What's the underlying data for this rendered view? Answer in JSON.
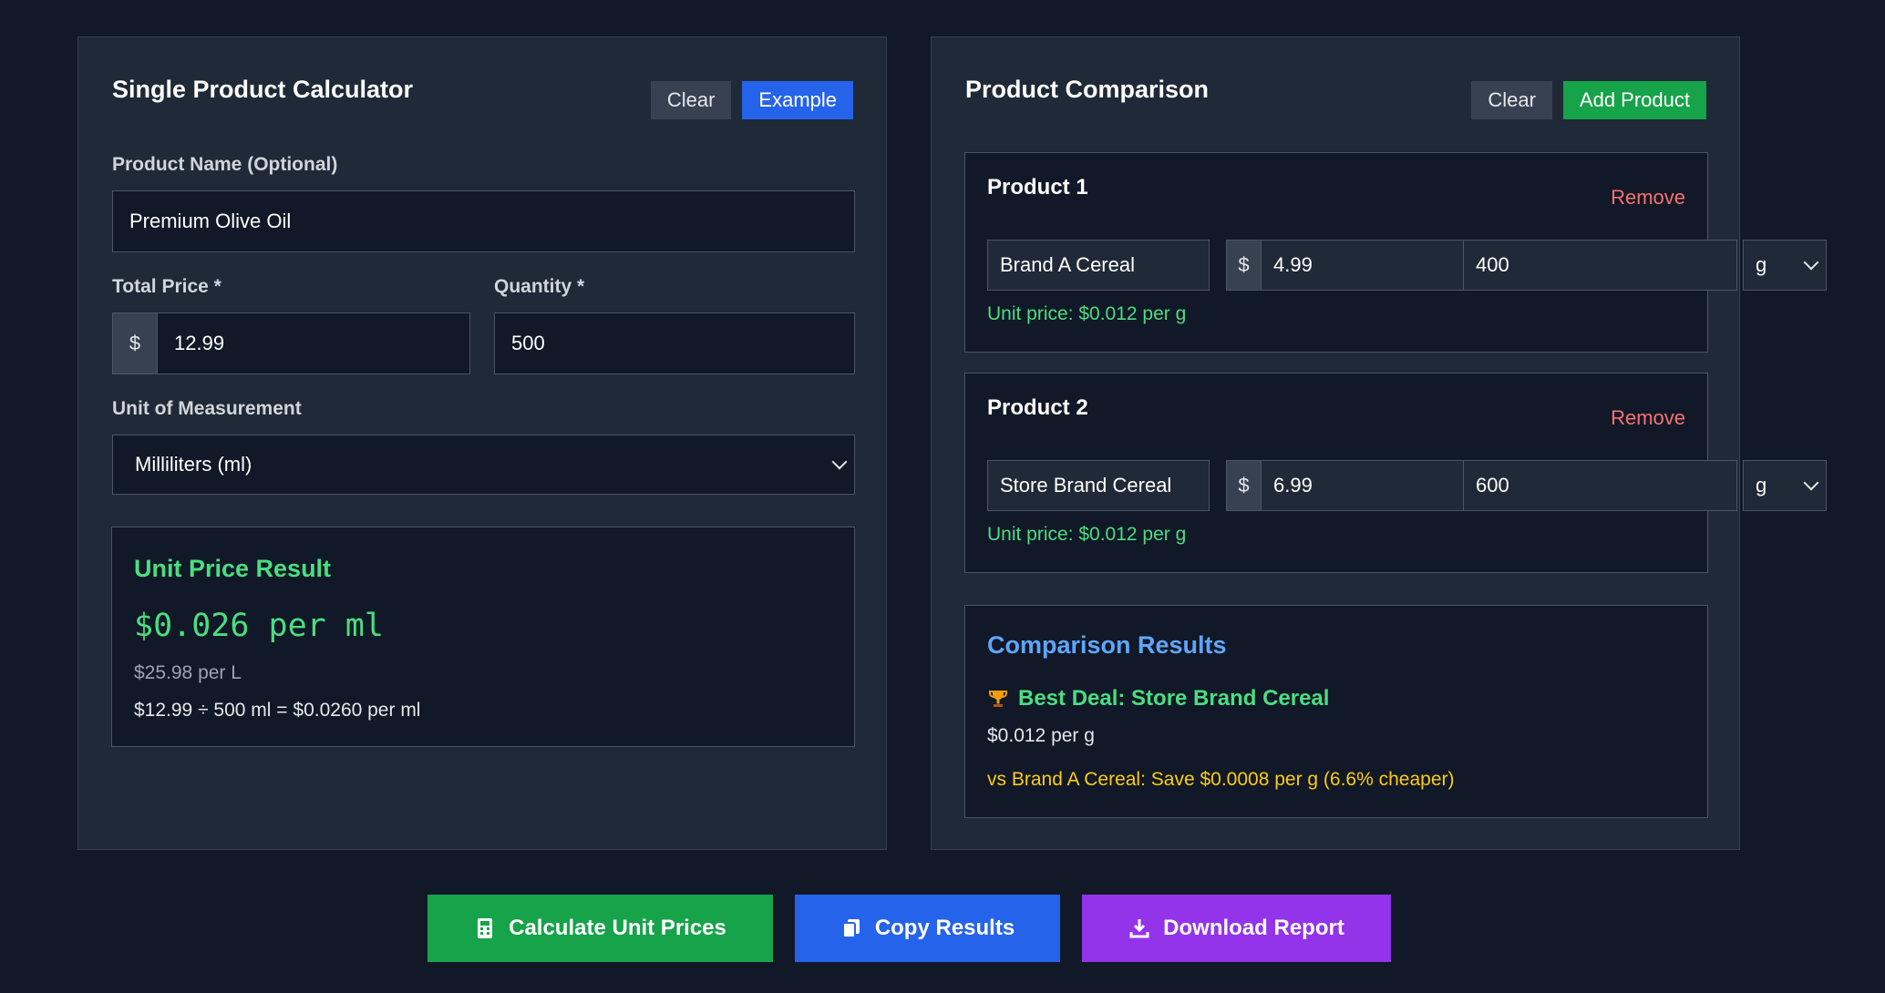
{
  "single": {
    "title": "Single Product Calculator",
    "clear_label": "Clear",
    "example_label": "Example",
    "product_name_label": "Product Name (Optional)",
    "product_name_value": "Premium Olive Oil",
    "total_price_label": "Total Price *",
    "currency_symbol": "$",
    "total_price_value": "12.99",
    "quantity_label": "Quantity *",
    "quantity_value": "500",
    "unit_label": "Unit of Measurement",
    "unit_value": "Milliliters (ml)",
    "result": {
      "title": "Unit Price Result",
      "main": "$0.026 per ml",
      "secondary": "$25.98 per L",
      "formula": "$12.99 ÷ 500 ml = $0.0260 per ml"
    }
  },
  "comparison": {
    "title": "Product Comparison",
    "clear_label": "Clear",
    "add_label": "Add Product",
    "remove_label": "Remove",
    "currency_symbol": "$",
    "products": [
      {
        "title": "Product 1",
        "name": "Brand A Cereal",
        "price": "4.99",
        "quantity": "400",
        "unit": "g",
        "unit_price": "Unit price: $0.012 per g"
      },
      {
        "title": "Product 2",
        "name": "Store Brand Cereal",
        "price": "6.99",
        "quantity": "600",
        "unit": "g",
        "unit_price": "Unit price: $0.012 per g"
      }
    ],
    "results": {
      "title": "Comparison Results",
      "best_deal": "Best Deal: Store Brand Cereal",
      "best_price": "$0.012 per g",
      "savings": "vs Brand A Cereal: Save $0.0008 per g (6.6% cheaper)"
    }
  },
  "actions": {
    "calculate_label": "Calculate Unit Prices",
    "copy_label": "Copy Results",
    "download_label": "Download Report"
  },
  "icons": {
    "calculate": "calculator-icon",
    "copy": "copy-icon",
    "download": "download-icon",
    "best_deal": "trophy-icon"
  },
  "colors": {
    "background": "#111827",
    "panel": "#1f2937",
    "accent_green": "#16a34a",
    "accent_blue": "#2563eb",
    "accent_purple": "#9333ea",
    "result_green": "#4ade80",
    "result_blue": "#60a5fa",
    "warning_yellow": "#facc15",
    "danger_red": "#f87171"
  }
}
